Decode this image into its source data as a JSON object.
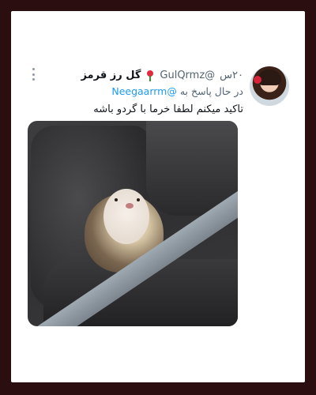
{
  "tweet": {
    "display_name": "گل رز قرمز",
    "handle": "@GulQrmz",
    "time": "۲۰س",
    "reply_prefix": "در حال پاسخ به",
    "reply_to": "@Neegaarrm",
    "text": "تاکید میکنم لطفا خرما با گردو باشه"
  },
  "icons": {
    "more": "more-vertical-icon",
    "name_emoji": "rose-emoji-icon"
  },
  "colors": {
    "frame": "#2a0e10",
    "mention": "#1d9bf0",
    "secondary_text": "#536471"
  }
}
